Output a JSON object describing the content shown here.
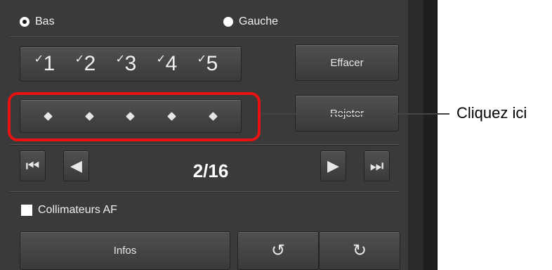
{
  "orientation": {
    "option_bottom": "Bas",
    "option_left": "Gauche"
  },
  "ratings": {
    "items": [
      "1",
      "2",
      "3",
      "4",
      "5"
    ],
    "tick": "✓",
    "clear_label": "Effacer"
  },
  "reject": {
    "label": "Rejeter"
  },
  "navigation": {
    "counter": "2/16",
    "first_icon": "⏮",
    "prev_icon": "◀",
    "next_icon": "▶",
    "last_icon": "⏭"
  },
  "af_points": {
    "label": "Collimateurs AF"
  },
  "bottom": {
    "info_label": "Infos",
    "rotate_left_icon": "↺",
    "rotate_right_icon": "↻"
  },
  "callout": {
    "text": "Cliquez ici"
  },
  "colors": {
    "highlight": "#e81212",
    "panel": "#3a3a3a"
  }
}
